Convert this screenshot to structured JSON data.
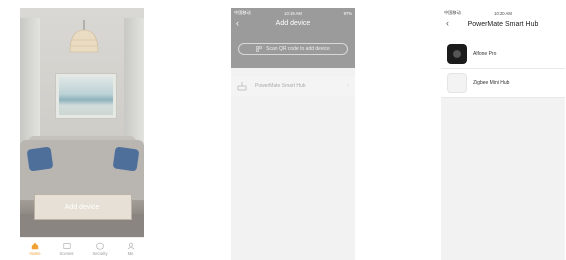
{
  "screen1": {
    "status": {
      "carrier": "",
      "time": "",
      "battery": ""
    },
    "add_device_label": "Add device",
    "tabs": [
      {
        "label": "Home",
        "icon": "home-icon",
        "active": true
      },
      {
        "label": "Scenes",
        "icon": "scenes-icon",
        "active": false
      },
      {
        "label": "Security",
        "icon": "security-icon",
        "active": false
      },
      {
        "label": "Me",
        "icon": "me-icon",
        "active": false
      }
    ],
    "colors": {
      "active_tab": "#f0a030"
    }
  },
  "screen2": {
    "status": {
      "carrier": "中国移动",
      "time": "10:19 AM",
      "battery": "97%"
    },
    "title": "Add device",
    "scan_label": "Scan QR code to add device",
    "device_row_label": "PowerMate Smart Hub",
    "colors": {
      "header": "#9b9b9b"
    }
  },
  "screen3": {
    "status": {
      "carrier": "中国移动",
      "time": "10:20 AM",
      "battery": ""
    },
    "title": "PowerMate Smart Hub",
    "items": [
      {
        "label": "Alfone Pro",
        "thumb": "dark"
      },
      {
        "label": "Zigbee Mini Hub",
        "thumb": "light"
      }
    ]
  }
}
